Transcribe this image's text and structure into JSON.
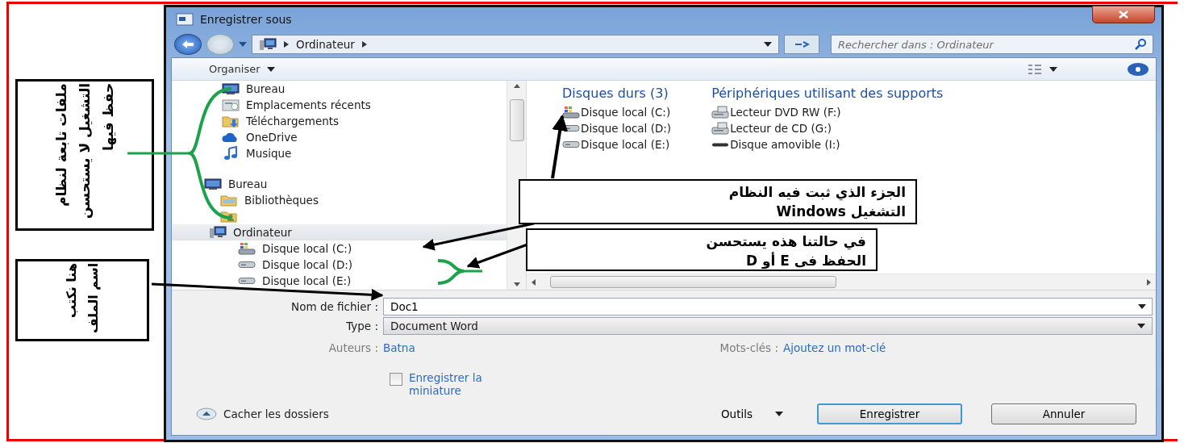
{
  "window": {
    "title": "Enregistrer sous"
  },
  "address_bar": {
    "path": [
      "Ordinateur"
    ]
  },
  "search": {
    "placeholder": "Rechercher dans : Ordinateur"
  },
  "toolbar": {
    "organize": "Organiser"
  },
  "navigation": [
    {
      "label": "Bureau",
      "kind": "desktop",
      "selected": false
    },
    {
      "label": "Emplacements récents",
      "kind": "recent",
      "selected": false
    },
    {
      "label": "Téléchargements",
      "kind": "downloads",
      "selected": false
    },
    {
      "label": "OneDrive",
      "kind": "cloud",
      "selected": false
    },
    {
      "label": "Musique",
      "kind": "music",
      "selected": false
    },
    {
      "label": "Bureau",
      "kind": "desktop",
      "selected": false,
      "children": [
        {
          "label": "Bibliothèques",
          "kind": "library",
          "selected": false
        },
        {
          "kind": "user-folder",
          "selected": false
        },
        {
          "label": "Ordinateur",
          "kind": "computer",
          "selected": true,
          "children": [
            {
              "label": "Disque local (C:)",
              "kind": "system-drive",
              "selected": false
            },
            {
              "label": "Disque local (D:)",
              "kind": "drive",
              "selected": false
            },
            {
              "label": "Disque local (E:)",
              "kind": "drive",
              "selected": false
            }
          ]
        }
      ]
    }
  ],
  "content": {
    "groups": [
      {
        "title": "Disques durs (3)",
        "items": [
          {
            "label": "Disque local (C:)",
            "kind": "system-drive"
          },
          {
            "label": "Disque local (D:)",
            "kind": "drive"
          },
          {
            "label": "Disque local (E:)",
            "kind": "drive"
          }
        ]
      },
      {
        "title": "Périphériques utilisant des supports",
        "items": [
          {
            "label": "Lecteur DVD RW (F:)",
            "kind": "optical-drive"
          },
          {
            "label": "Lecteur de CD (G:)",
            "kind": "optical-drive"
          },
          {
            "label": "Disque amovible (I:)",
            "kind": "removable-drive"
          }
        ]
      }
    ]
  },
  "form": {
    "filename": {
      "label": "Nom de fichier :",
      "value": "Doc1"
    },
    "type": {
      "label": "Type :",
      "value": "Document Word"
    },
    "authors": {
      "label": "Auteurs :",
      "value": "Batna"
    },
    "keywords": {
      "label": "Mots-clés :",
      "value": "Ajoutez un mot-clé"
    },
    "thumbnail": {
      "label": "Enregistrer la miniature",
      "checked": false
    }
  },
  "footer": {
    "hide_folders": "Cacher les dossiers",
    "tools": "Outils",
    "buttons": [
      {
        "label": "Enregistrer",
        "default": true
      },
      {
        "label": "Annuler",
        "default": false
      }
    ]
  },
  "annotations": {
    "left_notes": [
      "ملفات تابعة لنظام التشغيل لا يستحسن حفظ فيها",
      "هنا نكتب اسم الملف"
    ],
    "callouts": [
      "الجزء الذي ثبت فيه النظام التشغيل Windows",
      "في حالتنا هذه يستحسن الحفظ فى E أو D"
    ]
  }
}
